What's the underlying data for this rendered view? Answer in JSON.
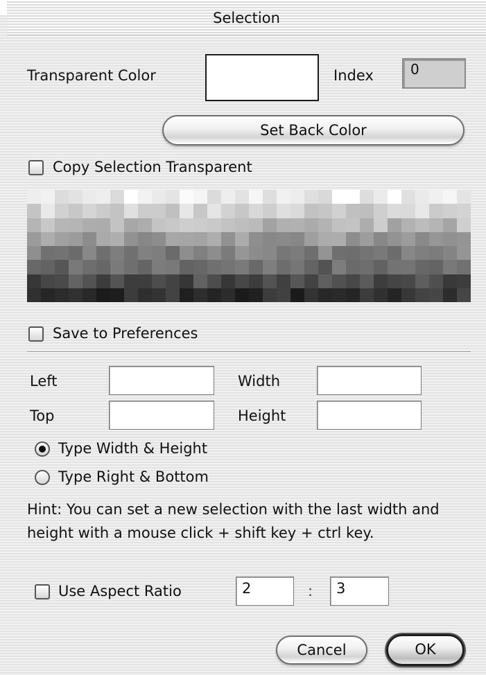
{
  "window": {
    "title": "Selection"
  },
  "transparent": {
    "label": "Transparent Color",
    "index_label": "Index",
    "index_value": "0"
  },
  "buttons": {
    "set_back_color": "Set Back Color",
    "cancel": "Cancel",
    "ok": "OK"
  },
  "checkboxes": {
    "copy_selection_transparent": {
      "label": "Copy Selection Transparent",
      "checked": false
    },
    "save_to_preferences": {
      "label": "Save to Preferences",
      "checked": false
    },
    "use_aspect_ratio": {
      "label": "Use Aspect Ratio",
      "checked": false
    }
  },
  "fields": {
    "left": {
      "label": "Left",
      "value": ""
    },
    "top": {
      "label": "Top",
      "value": ""
    },
    "width": {
      "label": "Width",
      "value": ""
    },
    "height": {
      "label": "Height",
      "value": ""
    }
  },
  "radios": {
    "type_width_height": {
      "label": "Type Width & Height",
      "selected": true
    },
    "type_right_bottom": {
      "label": "Type Right & Bottom",
      "selected": false
    }
  },
  "hint": "Hint: You can set a new selection with the last width and height with a mouse click + shift key + ctrl key.",
  "aspect": {
    "a": "2",
    "separator": ":",
    "b": "3"
  }
}
